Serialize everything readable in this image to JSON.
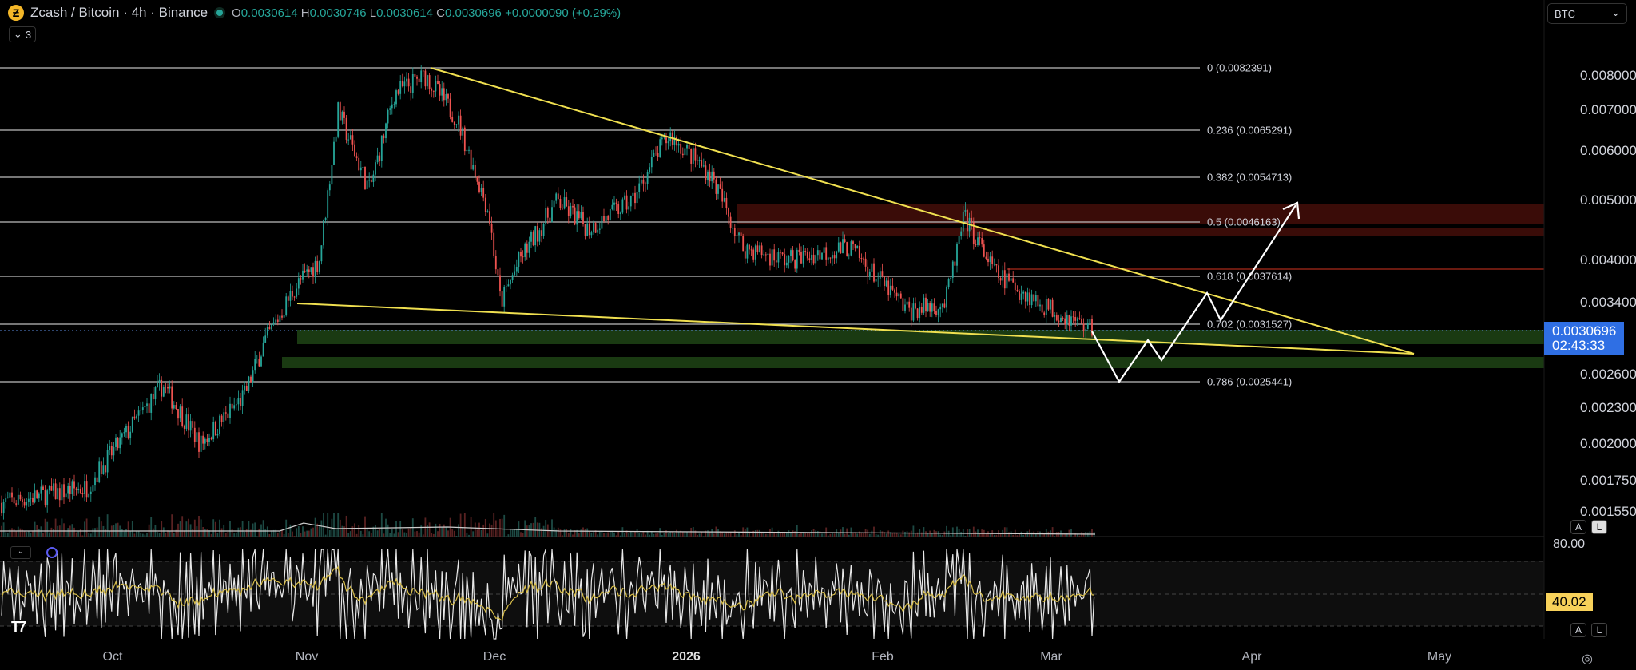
{
  "header": {
    "symbol": "Zcash / Bitcoin · 4h · Binance",
    "o_label": "O",
    "o": "0.0030614",
    "h_label": "H",
    "h": "0.0030746",
    "l_label": "L",
    "l": "0.0030614",
    "c_label": "C",
    "c": "0.0030696",
    "change": "+0.0000090 (+0.29%)",
    "indicators_count": "3",
    "coin_icon": "zcash-icon"
  },
  "currency_select": "BTC",
  "price_axis": [
    "0.0080000",
    "0.0070000",
    "0.0060000",
    "0.0050000",
    "0.0040000",
    "0.0034000",
    "0.0026000",
    "0.0023000",
    "0.0020000",
    "0.0017500",
    "0.0015500"
  ],
  "current_price": {
    "price": "0.0030696",
    "countdown": "02:43:33"
  },
  "fib_levels": [
    {
      "label": "0 (0.0082391)"
    },
    {
      "label": "0.236 (0.0065291)"
    },
    {
      "label": "0.382 (0.0054713)"
    },
    {
      "label": "0.5 (0.0046163)"
    },
    {
      "label": "0.618 (0.0037614)"
    },
    {
      "label": "0.702 (0.0031527)"
    },
    {
      "label": "0.786 (0.0025441)"
    }
  ],
  "time_axis": [
    "Oct",
    "Nov",
    "Dec",
    "2026",
    "Feb",
    "Mar",
    "Apr",
    "May"
  ],
  "rsi": {
    "upper": "80.00",
    "value": "40.02"
  },
  "scale_buttons": {
    "auto": "A",
    "log": "L"
  },
  "colors": {
    "up": "#26a69a",
    "down": "#ef5350",
    "trend": "#f0e050",
    "projection": "#ffffff",
    "resistance": "#3a0c08",
    "support": "#1a3a12",
    "price_tag": "#2f6fe4",
    "rsi_tag": "#f7d15a"
  },
  "chart_data": {
    "type": "candlestick",
    "title": "Zcash / Bitcoin · 4h · Binance",
    "scale": "log",
    "ylim": [
      0.00155,
      0.0085
    ],
    "approx_close_path": [
      [
        "Sep 13",
        0.0016
      ],
      [
        "Sep 27",
        0.0017
      ],
      [
        "Oct 9",
        0.0025
      ],
      [
        "Oct 15",
        0.002
      ],
      [
        "Oct 22",
        0.0024
      ],
      [
        "Oct 25",
        0.0029
      ],
      [
        "Oct 30",
        0.0036
      ],
      [
        "Nov 3",
        0.004
      ],
      [
        "Nov 6",
        0.007
      ],
      [
        "Nov 11",
        0.0052
      ],
      [
        "Nov 15",
        0.0075
      ],
      [
        "Nov 20",
        0.008
      ],
      [
        "Nov 25",
        0.0068
      ],
      [
        "Nov 30",
        0.0048
      ],
      [
        "Dec 2",
        0.0034
      ],
      [
        "Dec 5",
        0.004
      ],
      [
        "Dec 11",
        0.005
      ],
      [
        "Dec 16",
        0.0045
      ],
      [
        "Dec 23",
        0.005
      ],
      [
        "Dec 27",
        0.006
      ],
      [
        "Dec 29",
        0.0064
      ],
      [
        "Jan 5",
        0.0055
      ],
      [
        "Jan 10",
        0.0042
      ],
      [
        "Jan 17",
        0.004
      ],
      [
        "Jan 27",
        0.0042
      ],
      [
        "Feb 5",
        0.0033
      ],
      [
        "Feb 11",
        0.0034
      ],
      [
        "Feb 14",
        0.0047
      ],
      [
        "Feb 19",
        0.0038
      ],
      [
        "Feb 26",
        0.0034
      ],
      [
        "Mar 8",
        0.0030696
      ]
    ]
  }
}
